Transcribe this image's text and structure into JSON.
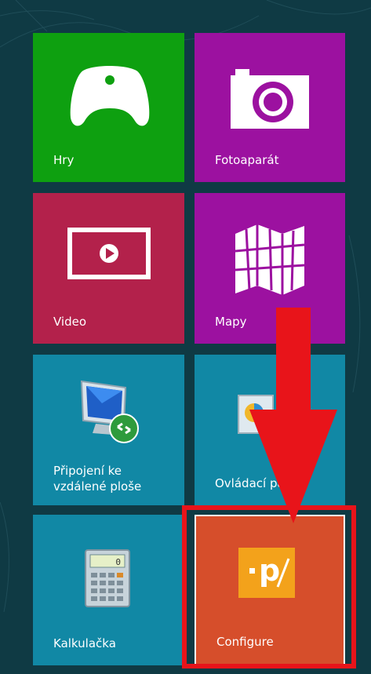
{
  "tiles": {
    "hry": {
      "label": "Hry",
      "icon": "gamepad-icon"
    },
    "fotoaparat": {
      "label": "Fotoaparát",
      "icon": "camera-icon"
    },
    "video": {
      "label": "Video",
      "icon": "video-player-icon"
    },
    "mapy": {
      "label": "Mapy",
      "icon": "map-icon"
    },
    "pripojeni": {
      "label_line1": "Připojení ke",
      "label_line2": "vzdálené ploše",
      "icon": "remote-desktop-icon"
    },
    "ovladaci": {
      "label": "Ovládací panely",
      "icon": "control-panel-icon"
    },
    "kalkulacka": {
      "label": "Kalkulačka",
      "icon": "calculator-icon"
    },
    "configure": {
      "label": "Configure",
      "icon": "configure-app-icon"
    }
  },
  "colors": {
    "background": "#0f3a44",
    "green": "#0ea010",
    "purple": "#9c11a0",
    "crimson": "#b3214b",
    "teal": "#1188a5",
    "orange": "#d64e2b",
    "annotation_red": "#e8141a"
  }
}
